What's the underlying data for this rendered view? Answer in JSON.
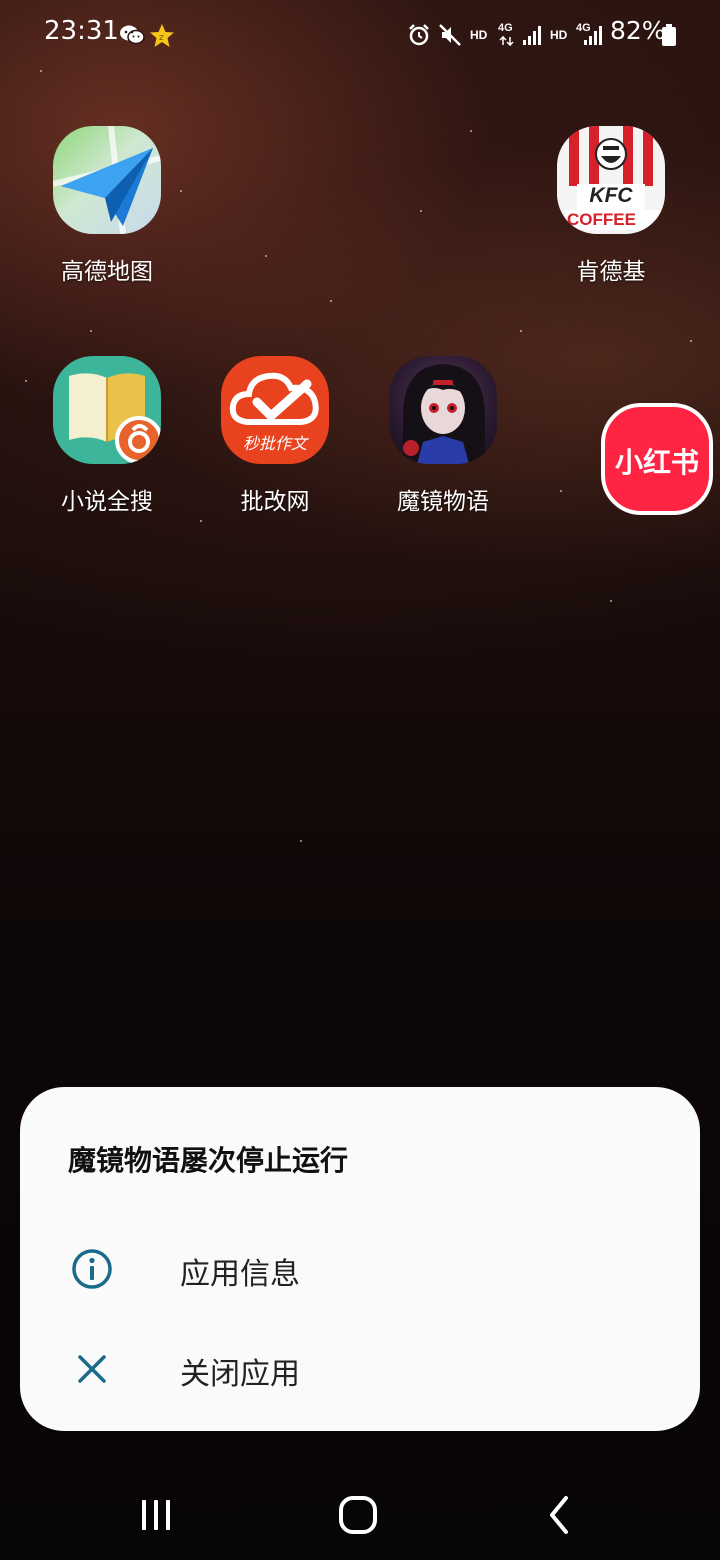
{
  "status_bar": {
    "time": "23:31",
    "battery_percent": "82%",
    "hd_label_1": "HD",
    "hd_label_2": "HD",
    "net_label_1": "4G",
    "net_label_2": "4G",
    "icons": [
      "wechat-icon",
      "star-badge-icon",
      "alarm-icon",
      "mute-icon",
      "signal-icon",
      "battery-icon"
    ]
  },
  "home": {
    "apps": [
      {
        "label": "高德地图",
        "icon": "amap-icon"
      },
      {
        "label": "肯德基",
        "icon": "kfc-icon",
        "icon_text_1": "KFC",
        "icon_text_2": "COFFEE"
      },
      {
        "label": "小说全搜",
        "icon": "novel-search-icon"
      },
      {
        "label": "批改网",
        "icon": "pigai-icon",
        "icon_text": "秒批作文"
      },
      {
        "label": "魔镜物语",
        "icon": "mirror-tale-icon"
      },
      {
        "label": "",
        "icon": "xiaohongshu-icon",
        "icon_text": "小红书"
      }
    ]
  },
  "dialog": {
    "title": "魔镜物语屡次停止运行",
    "options": [
      {
        "label": "应用信息",
        "icon": "info-icon"
      },
      {
        "label": "关闭应用",
        "icon": "close-icon"
      }
    ],
    "accent_color": "#1a6a8a"
  },
  "nav_bar": {
    "buttons": [
      "recent-apps",
      "home",
      "back"
    ]
  }
}
